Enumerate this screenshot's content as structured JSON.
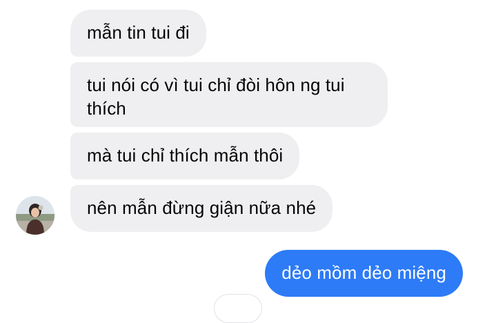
{
  "conversation": {
    "incoming": [
      {
        "text": "mẫn tin tui đi"
      },
      {
        "text": "tui nói có vì tui chỉ đòi hôn ng tui thích"
      },
      {
        "text": "mà tui chỉ thích mẫn thôi"
      },
      {
        "text": "nên mẫn đừng giận nữa nhé"
      }
    ],
    "outgoing": [
      {
        "text": "dẻo mồm dẻo miệng"
      }
    ]
  },
  "colors": {
    "incoming_bubble": "#efeff1",
    "outgoing_bubble": "#2d7bf6"
  },
  "icons": {
    "avatar": "user-avatar-photo"
  }
}
